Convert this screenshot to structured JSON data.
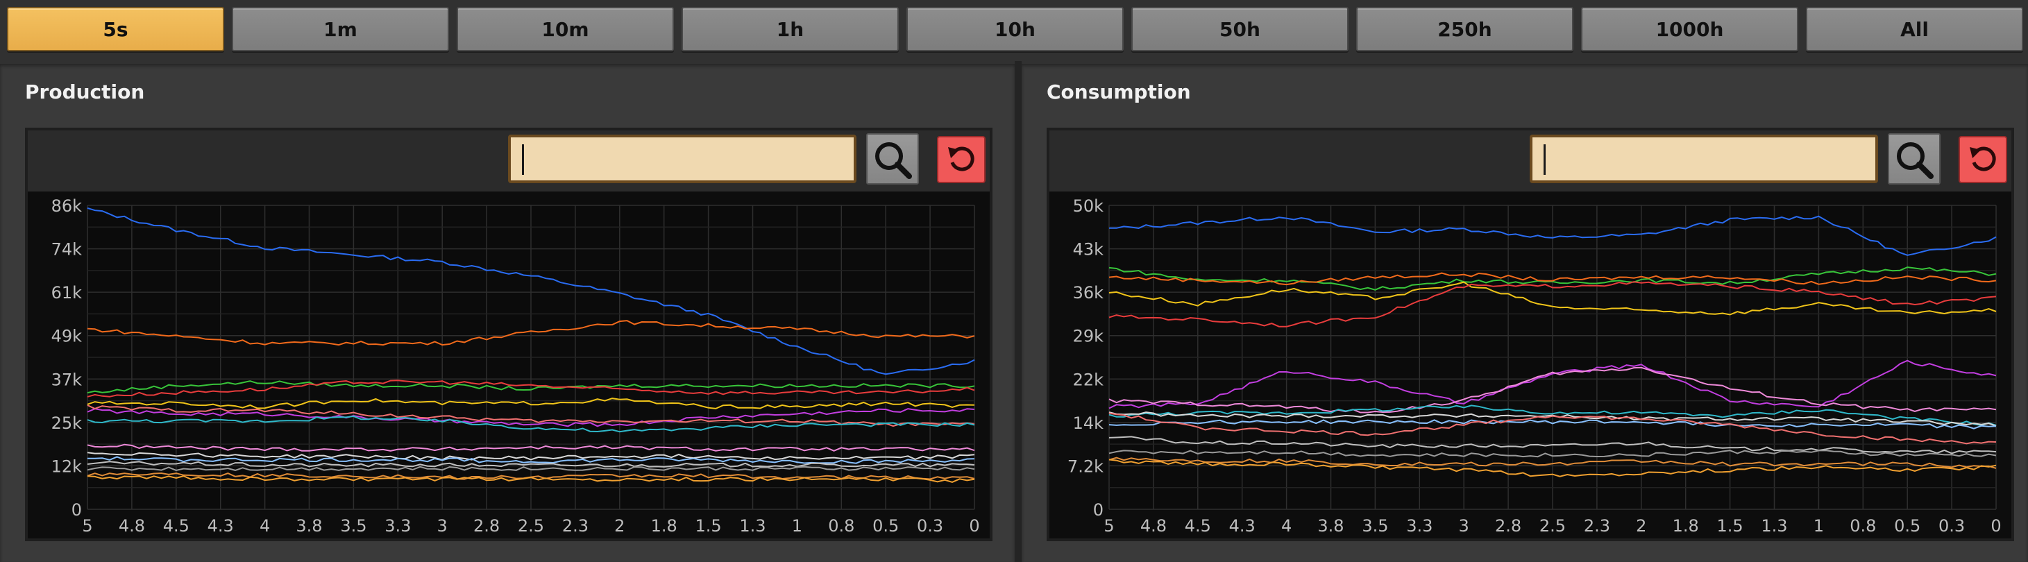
{
  "time_tabs": [
    {
      "label": "5s",
      "active": true
    },
    {
      "label": "1m"
    },
    {
      "label": "10m"
    },
    {
      "label": "1h"
    },
    {
      "label": "10h"
    },
    {
      "label": "50h"
    },
    {
      "label": "250h"
    },
    {
      "label": "1000h"
    },
    {
      "label": "All"
    }
  ],
  "colors": {
    "tab_active": "#f0b857",
    "search_bg": "#f0d9b0",
    "reset_red": "#f05858",
    "series_palette": [
      "#2a6cf2",
      "#f26a1b",
      "#38c53a",
      "#e83c3c",
      "#f0c419",
      "#c23ee0",
      "#f07070",
      "#2fb8c9",
      "#d8d8d8",
      "#ee8ad9",
      "#bfbfbf",
      "#e08c38",
      "#9a9a9a",
      "#88c0ff"
    ]
  },
  "icons": {
    "search": "magnifier-icon",
    "reset": "reset-arrow-icon"
  },
  "production": {
    "title": "Production",
    "search": {
      "value": "",
      "placeholder": ""
    },
    "chart_data": {
      "type": "line",
      "title": "",
      "xlabel": "",
      "ylabel": "",
      "x_ticks": [
        "5",
        "4.8",
        "4.5",
        "4.3",
        "4",
        "3.8",
        "3.5",
        "3.3",
        "3",
        "2.8",
        "2.5",
        "2.3",
        "2",
        "1.8",
        "1.5",
        "1.3",
        "1",
        "0.8",
        "0.5",
        "0.3",
        "0"
      ],
      "y_ticks": [
        "0",
        "12k",
        "25k",
        "37k",
        "49k",
        "61k",
        "74k",
        "86k"
      ],
      "xlim": [
        5,
        0
      ],
      "ylim": [
        0,
        86000
      ],
      "grid": true,
      "x": [
        5,
        4.5,
        4,
        3.5,
        3,
        2.5,
        2,
        1.5,
        1,
        0.5,
        0
      ],
      "series": [
        {
          "color": "#2a6cf2",
          "values": [
            85000,
            79000,
            74000,
            72000,
            70000,
            66000,
            61000,
            55000,
            46000,
            38000,
            42000
          ]
        },
        {
          "color": "#f26a1b",
          "values": [
            51000,
            49000,
            47000,
            47000,
            47000,
            50000,
            53000,
            52000,
            51000,
            49000,
            49000
          ]
        },
        {
          "color": "#38c53a",
          "values": [
            33000,
            35000,
            36000,
            35000,
            35000,
            34000,
            35000,
            35000,
            35000,
            35000,
            35000
          ]
        },
        {
          "color": "#e83c3c",
          "values": [
            32000,
            33000,
            34000,
            36000,
            36000,
            35000,
            34000,
            33000,
            33000,
            33000,
            34000
          ]
        },
        {
          "color": "#f0c419",
          "values": [
            30000,
            30000,
            29000,
            31000,
            30000,
            30000,
            31000,
            29000,
            29000,
            30000,
            29000
          ]
        },
        {
          "color": "#c23ee0",
          "values": [
            28000,
            27000,
            27000,
            26000,
            25000,
            24000,
            24000,
            26000,
            27000,
            28000,
            28000
          ]
        },
        {
          "color": "#f07070",
          "values": [
            29000,
            28000,
            28000,
            27000,
            26000,
            25000,
            25000,
            25000,
            25000,
            24000,
            24000
          ]
        },
        {
          "color": "#2fb8c9",
          "values": [
            25000,
            25000,
            25000,
            26000,
            25000,
            23000,
            22000,
            23000,
            24000,
            24000,
            24000
          ]
        },
        {
          "color": "#ee8ad9",
          "values": [
            18000,
            17500,
            17000,
            17000,
            17000,
            17500,
            17500,
            17000,
            17000,
            17000,
            17000
          ]
        },
        {
          "color": "#d8d8d8",
          "values": [
            16000,
            15500,
            15000,
            15000,
            14500,
            14500,
            15000,
            15000,
            14500,
            14500,
            15000
          ]
        },
        {
          "color": "#88c0ff",
          "values": [
            14500,
            14000,
            14000,
            14000,
            14000,
            13500,
            14000,
            14000,
            13500,
            13500,
            14000
          ]
        },
        {
          "color": "#bfbfbf",
          "values": [
            13000,
            13000,
            12500,
            12500,
            12500,
            12500,
            12500,
            12500,
            12500,
            12500,
            12500
          ]
        },
        {
          "color": "#9a9a9a",
          "values": [
            11500,
            11500,
            11500,
            11500,
            11500,
            11500,
            11500,
            11500,
            11500,
            11500,
            11500
          ]
        },
        {
          "color": "#e08c38",
          "values": [
            10000,
            10000,
            9500,
            9500,
            9000,
            9000,
            9500,
            9500,
            9000,
            9000,
            9000
          ]
        },
        {
          "color": "#f0a030",
          "values": [
            9000,
            9000,
            8500,
            8500,
            8500,
            8500,
            8500,
            8500,
            8500,
            8500,
            8000
          ]
        }
      ]
    }
  },
  "consumption": {
    "title": "Consumption",
    "search": {
      "value": "",
      "placeholder": ""
    },
    "chart_data": {
      "type": "line",
      "title": "",
      "xlabel": "",
      "ylabel": "",
      "x_ticks": [
        "5",
        "4.8",
        "4.5",
        "4.3",
        "4",
        "3.8",
        "3.5",
        "3.3",
        "3",
        "2.8",
        "2.5",
        "2.3",
        "2",
        "1.8",
        "1.5",
        "1.3",
        "1",
        "0.8",
        "0.5",
        "0.3",
        "0"
      ],
      "y_ticks": [
        "0",
        "7.2k",
        "14k",
        "22k",
        "29k",
        "36k",
        "43k",
        "50k"
      ],
      "xlim": [
        5,
        0
      ],
      "ylim": [
        0,
        50400
      ],
      "grid": true,
      "x": [
        5,
        4.5,
        4,
        3.5,
        3,
        2.5,
        2,
        1.5,
        1,
        0.5,
        0
      ],
      "series": [
        {
          "color": "#2a6cf2",
          "values": [
            46500,
            47500,
            48500,
            46000,
            46500,
            45000,
            45500,
            48000,
            48500,
            42000,
            45000
          ]
        },
        {
          "color": "#38c53a",
          "values": [
            40000,
            38000,
            38000,
            36500,
            38000,
            37500,
            38000,
            37500,
            39000,
            40000,
            39000
          ]
        },
        {
          "color": "#f26a1b",
          "values": [
            38500,
            38000,
            37500,
            38500,
            39000,
            38000,
            38500,
            38500,
            37500,
            38500,
            38000
          ]
        },
        {
          "color": "#f0c419",
          "values": [
            36000,
            34000,
            36500,
            35000,
            37500,
            33500,
            33000,
            32500,
            34000,
            32500,
            33000
          ]
        },
        {
          "color": "#e83c3c",
          "values": [
            32000,
            31500,
            30500,
            32000,
            37000,
            37000,
            37500,
            37000,
            36000,
            34000,
            35000
          ]
        },
        {
          "color": "#c23ee0",
          "values": [
            17000,
            17500,
            23000,
            21000,
            17500,
            22500,
            24000,
            18000,
            17000,
            24500,
            22000
          ]
        },
        {
          "color": "#ee8ad9",
          "values": [
            18000,
            17500,
            17000,
            16000,
            18000,
            22500,
            23500,
            20000,
            17500,
            16500,
            16500
          ]
        },
        {
          "color": "#2fb8c9",
          "values": [
            15500,
            16000,
            16000,
            16500,
            17000,
            16000,
            16000,
            15500,
            16500,
            15000,
            14000
          ]
        },
        {
          "color": "#d8d8d8",
          "values": [
            16000,
            15500,
            15500,
            15500,
            15500,
            15500,
            15000,
            15000,
            15000,
            14500,
            14000
          ]
        },
        {
          "color": "#88c0ff",
          "values": [
            14000,
            14500,
            14500,
            14500,
            14500,
            14500,
            14500,
            14000,
            14000,
            14000,
            13500
          ]
        },
        {
          "color": "#f07070",
          "values": [
            16000,
            13500,
            13000,
            12500,
            14000,
            15500,
            15000,
            14000,
            12500,
            11500,
            11000
          ]
        },
        {
          "color": "#bfbfbf",
          "values": [
            12000,
            11000,
            11000,
            10500,
            10500,
            10500,
            11000,
            10000,
            10000,
            9500,
            9500
          ]
        },
        {
          "color": "#9a9a9a",
          "values": [
            9500,
            9500,
            9500,
            9000,
            9000,
            9000,
            9000,
            9500,
            9500,
            9000,
            9000
          ]
        },
        {
          "color": "#e08c38",
          "values": [
            8500,
            8000,
            8000,
            7500,
            7500,
            7500,
            8000,
            7500,
            7500,
            7500,
            7000
          ]
        },
        {
          "color": "#f0a030",
          "values": [
            8000,
            7500,
            7500,
            7000,
            6500,
            5500,
            6000,
            6500,
            7000,
            6500,
            7000
          ]
        }
      ]
    }
  }
}
